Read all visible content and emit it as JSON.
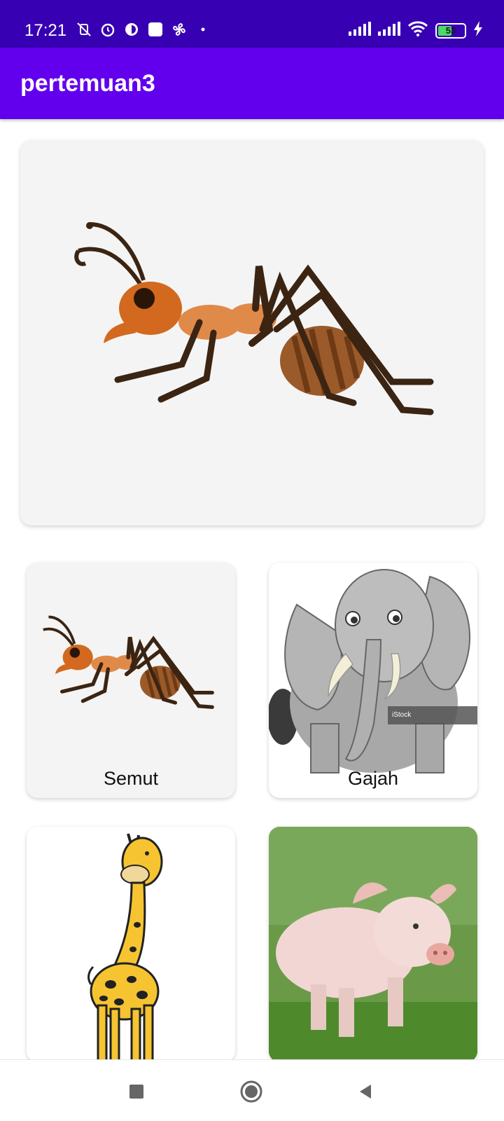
{
  "status_bar": {
    "time": "17:21",
    "battery": "53",
    "left_icons": [
      "mute-vibrate-icon",
      "alarm-icon",
      "circle-half-icon",
      "square-app-icon",
      "fan-icon",
      "dot-icon"
    ],
    "right_icons": [
      "signal-icon",
      "signal-icon",
      "wifi-icon",
      "battery-icon",
      "charging-icon"
    ]
  },
  "app_bar": {
    "title": "pertemuan3"
  },
  "hero": {
    "image": "ant-illustration"
  },
  "animals": [
    {
      "label": "Semut",
      "image": "ant-illustration"
    },
    {
      "label": "Gajah",
      "image": "elephant-illustration"
    },
    {
      "label": "",
      "image": "giraffe-illustration"
    },
    {
      "label": "",
      "image": "pig-photo"
    }
  ],
  "colors": {
    "status_bar": "#3700b3",
    "app_bar": "#6200ee",
    "card_bg": "#f4f4f4"
  },
  "nav_bar": {
    "icons": [
      "recent-apps-icon",
      "home-icon",
      "back-icon"
    ]
  }
}
